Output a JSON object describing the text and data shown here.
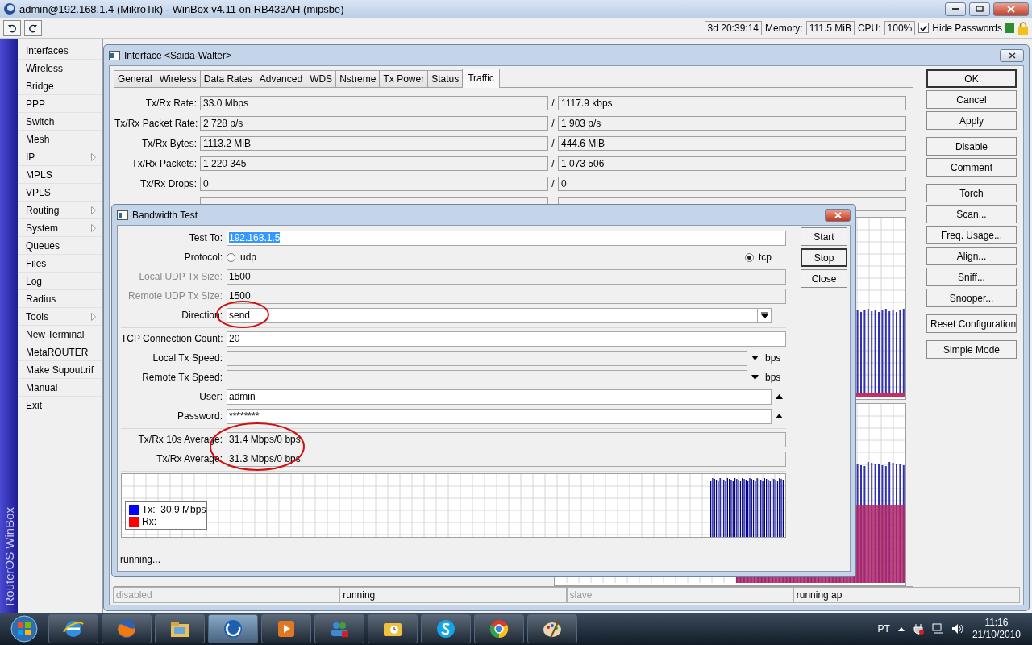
{
  "app_title": "admin@192.168.1.4 (MikroTik) - WinBox v4.11 on RB433AH (mipsbe)",
  "toolbar": {
    "uptime": "3d 20:39:14",
    "memory_label": "Memory:",
    "memory": "111.5 MiB",
    "cpu_label": "CPU:",
    "cpu": "100%",
    "hide_passwords": {
      "label": "Hide Passwords",
      "checked": true
    }
  },
  "side_label": "RouterOS WinBox",
  "menu": [
    {
      "label": "Interfaces",
      "submenu": false
    },
    {
      "label": "Wireless",
      "submenu": false
    },
    {
      "label": "Bridge",
      "submenu": false
    },
    {
      "label": "PPP",
      "submenu": false
    },
    {
      "label": "Switch",
      "submenu": false
    },
    {
      "label": "Mesh",
      "submenu": false
    },
    {
      "label": "IP",
      "submenu": true
    },
    {
      "label": "MPLS",
      "submenu": false
    },
    {
      "label": "VPLS",
      "submenu": false
    },
    {
      "label": "Routing",
      "submenu": true
    },
    {
      "label": "System",
      "submenu": true
    },
    {
      "label": "Queues",
      "submenu": false
    },
    {
      "label": "Files",
      "submenu": false
    },
    {
      "label": "Log",
      "submenu": false
    },
    {
      "label": "Radius",
      "submenu": false
    },
    {
      "label": "Tools",
      "submenu": true
    },
    {
      "label": "New Terminal",
      "submenu": false
    },
    {
      "label": "MetaROUTER",
      "submenu": false
    },
    {
      "label": "Make Supout.rif",
      "submenu": false
    },
    {
      "label": "Manual",
      "submenu": false
    },
    {
      "label": "Exit",
      "submenu": false
    }
  ],
  "interface_window": {
    "title": "Interface <Saida-Walter>",
    "tabs": [
      {
        "label": "General",
        "selected": false
      },
      {
        "label": "Wireless",
        "selected": false
      },
      {
        "label": "Data Rates",
        "selected": false
      },
      {
        "label": "Advanced",
        "selected": false
      },
      {
        "label": "WDS",
        "selected": false
      },
      {
        "label": "Nstreme",
        "selected": false
      },
      {
        "label": "Tx Power",
        "selected": false
      },
      {
        "label": "Status",
        "selected": false
      },
      {
        "label": "Traffic",
        "selected": true
      }
    ],
    "rows": [
      {
        "label": "Tx/Rx Rate:",
        "tx": "33.0 Mbps",
        "divider": "/",
        "rx": "1117.9 kbps"
      },
      {
        "label": "Tx/Rx Packet Rate:",
        "tx": "2 728 p/s",
        "divider": "/",
        "rx": "1 903 p/s"
      },
      {
        "label": "Tx/Rx Bytes:",
        "tx": "1113.2 MiB",
        "divider": "/",
        "rx": "444.6 MiB"
      },
      {
        "label": "Tx/Rx Packets:",
        "tx": "1 220 345",
        "divider": "/",
        "rx": "1 073 506"
      },
      {
        "label": "Tx/Rx Drops:",
        "tx": "0",
        "divider": "/",
        "rx": "0"
      }
    ],
    "button_groups": [
      [
        {
          "label": "OK",
          "default": true
        },
        {
          "label": "Cancel",
          "default": false
        },
        {
          "label": "Apply",
          "default": false
        }
      ],
      [
        {
          "label": "Disable",
          "default": false
        },
        {
          "label": "Comment",
          "default": false
        }
      ],
      [
        {
          "label": "Torch",
          "default": false
        },
        {
          "label": "Scan...",
          "default": false
        },
        {
          "label": "Freq. Usage...",
          "default": false
        },
        {
          "label": "Align...",
          "default": false
        },
        {
          "label": "Sniff...",
          "default": false
        },
        {
          "label": "Snooper...",
          "default": false
        }
      ],
      [
        {
          "label": "Reset Configuration",
          "default": false
        }
      ],
      [
        {
          "label": "Simple Mode",
          "default": false
        }
      ]
    ],
    "status_bar": [
      {
        "text": "disabled",
        "disabled": true
      },
      {
        "text": "running",
        "disabled": false
      },
      {
        "text": "slave",
        "disabled": true
      },
      {
        "text": "running ap",
        "disabled": false
      }
    ]
  },
  "bandwidth_test": {
    "title": "Bandwidth Test",
    "sections": [
      [
        {
          "kind": "text",
          "label": "Test To:",
          "value": "192.168.1.5",
          "disabled": false,
          "value_selected": true
        },
        {
          "kind": "radio",
          "label": "Protocol:",
          "options": [
            {
              "label": "udp",
              "selected": false
            },
            {
              "label": "tcp",
              "selected": true
            }
          ]
        },
        {
          "kind": "text",
          "label": "Local UDP Tx Size:",
          "value": "1500",
          "disabled": true,
          "value_selected": false
        },
        {
          "kind": "text",
          "label": "Remote UDP Tx Size:",
          "value": "1500",
          "disabled": true,
          "value_selected": false
        },
        {
          "kind": "dropdown",
          "label": "Direction:",
          "value": "send"
        }
      ],
      [
        {
          "kind": "text",
          "label": "TCP Connection Count:",
          "value": "20",
          "disabled": false,
          "value_selected": false
        },
        {
          "kind": "speed",
          "label": "Local Tx Speed:",
          "unit": "bps"
        },
        {
          "kind": "speed",
          "label": "Remote Tx Speed:",
          "unit": "bps"
        },
        {
          "kind": "expander",
          "label": "User:",
          "value": "admin"
        },
        {
          "kind": "expander",
          "label": "Password:",
          "value": "********"
        }
      ],
      [
        {
          "kind": "readonly",
          "label": "Tx/Rx 10s Average:",
          "value": "31.4 Mbps/0 bps"
        },
        {
          "kind": "readonly",
          "label": "Tx/Rx Average:",
          "value": "31.3 Mbps/0 bps"
        }
      ]
    ],
    "legend": [
      {
        "label": "Tx:",
        "value": "30.9 Mbps",
        "color": "#0000ff"
      },
      {
        "label": "Rx:",
        "color": "#ff0000"
      }
    ],
    "buttons": [
      {
        "label": "Start",
        "default": false
      },
      {
        "label": "Stop",
        "default": true
      },
      {
        "label": "Close",
        "default": false
      }
    ],
    "status": "running..."
  },
  "taskbar": {
    "language": "PT",
    "time": "11:16",
    "date": "21/10/2010"
  }
}
